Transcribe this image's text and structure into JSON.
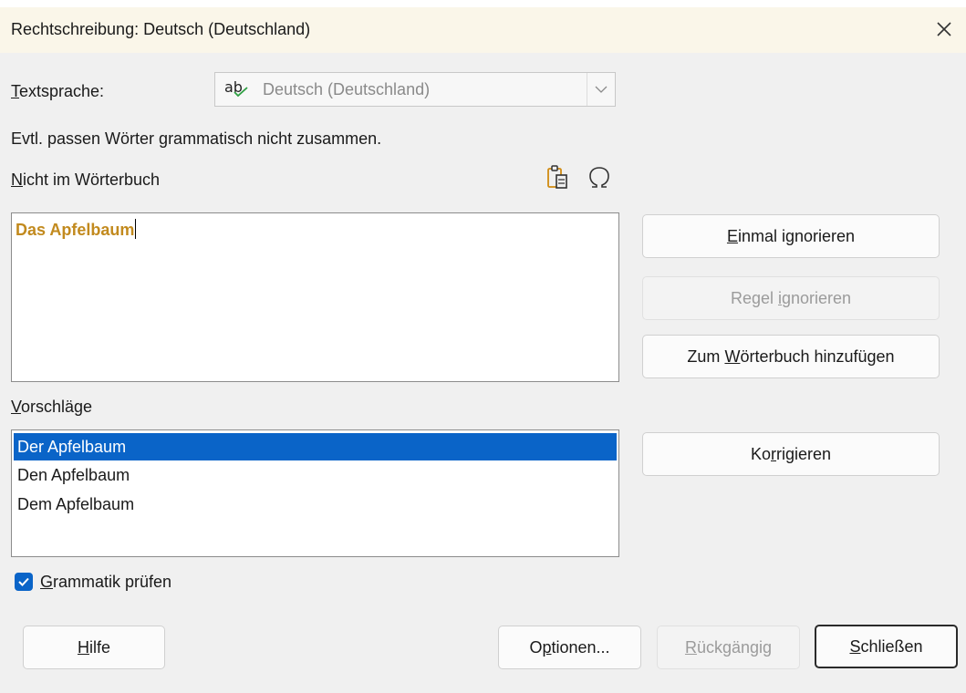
{
  "window": {
    "title": "Rechtschreibung: Deutsch (Deutschland)"
  },
  "text_language": {
    "label_underlined": "T",
    "label_rest": "extsprache:",
    "value": "Deutsch (Deutschland)",
    "icon_text": "ab"
  },
  "info_message": "Evtl. passen Wörter grammatisch nicht zusammen.",
  "not_in_dictionary": {
    "label_underlined": "N",
    "label_rest": "icht im Wörterbuch",
    "text": "Das Apfelbaum"
  },
  "suggestions": {
    "label_underlined": "V",
    "label_rest": "orschläge",
    "items": [
      "Der Apfelbaum",
      "Den Apfelbaum",
      "Dem Apfelbaum"
    ],
    "selected_index": 0
  },
  "buttons": {
    "ignore_once": {
      "u": "E",
      "rest": "inmal ignorieren"
    },
    "ignore_rule": {
      "pre": "Regel ",
      "u": "i",
      "rest": "gnorieren"
    },
    "add_to_dictionary": {
      "pre": "Zum ",
      "u": "W",
      "rest": "örterbuch hinzufügen"
    },
    "correct": {
      "pre": "Ko",
      "u": "r",
      "rest": "rigieren"
    },
    "help": {
      "u": "H",
      "rest": "ilfe"
    },
    "options": {
      "pre": "O",
      "u": "p",
      "rest": "tionen..."
    },
    "undo": {
      "u": "R",
      "rest": "ückgängig"
    },
    "close": {
      "u": "S",
      "rest": "chließen"
    }
  },
  "check_grammar": {
    "u": "G",
    "rest": "rammatik prüfen",
    "checked": true
  },
  "colors": {
    "accent": "#0a64c8",
    "error_text": "#c28a1e",
    "titlebar": "#faf6e9"
  }
}
